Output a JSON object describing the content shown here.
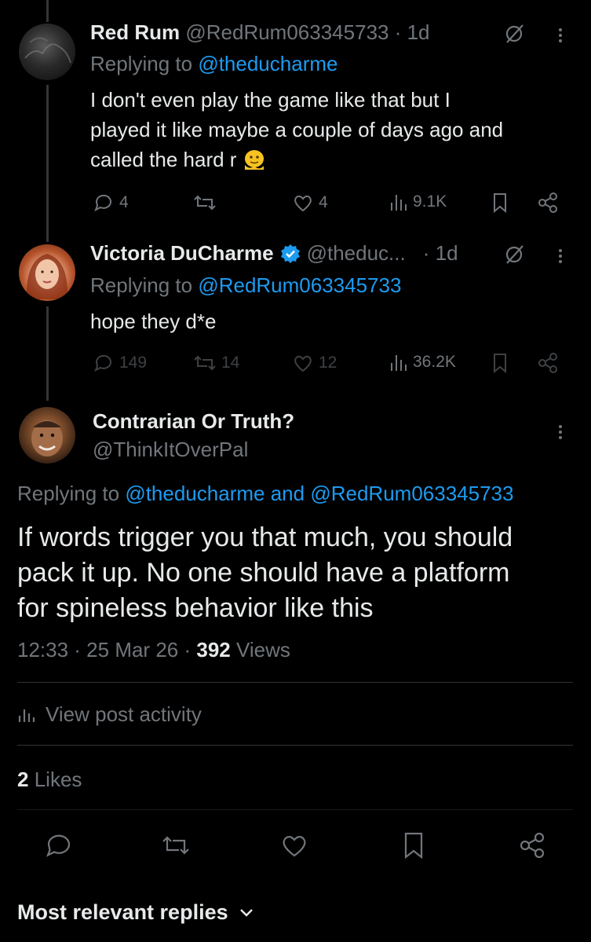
{
  "replies": [
    {
      "name": "Red Rum",
      "handle": "@RedRum063345733",
      "time": "· 1d",
      "replying_prefix": "Replying to",
      "replying_to": "@theducharme",
      "text_lines": [
        "I don't even play the game like that but I",
        "played it like maybe a couple of days ago and",
        "called the hard r"
      ],
      "emoji": "🫠",
      "stats": {
        "replies": "4",
        "reposts": "",
        "likes": "4",
        "views": "9.1K"
      }
    },
    {
      "name": "Victoria DuCharme",
      "handle": "@theduc...",
      "time": "· 1d",
      "replying_prefix": "Replying to",
      "replying_to": "@RedRum063345733",
      "text_lines": [
        "hope they d*e"
      ],
      "stats": {
        "replies": "149",
        "reposts": "14",
        "likes": "12",
        "views": "36.2K"
      }
    }
  ],
  "main_post": {
    "name": "Contrarian Or Truth?",
    "handle": "@ThinkItOverPal",
    "replying_prefix": "Replying to",
    "replying_to_1": "@theducharme",
    "replying_and": "and",
    "replying_to_2": "@RedRum063345733",
    "text_lines": [
      "If words trigger you that much, you should",
      "pack it up. No one should have a platform",
      "for spineless behavior like this"
    ],
    "time": "12:33 · 25 Mar 26 ·",
    "views_count": "392",
    "views_label": "Views",
    "activity_label": "View post activity",
    "likes_count": "2",
    "likes_label": "Likes"
  },
  "sort_label": "Most relevant replies",
  "colors": {
    "background": "#000000",
    "text": "#e7e9ea",
    "secondary": "#71767b",
    "accent": "#1d9bf0",
    "verified": "#1d9bf0"
  },
  "icons": [
    "reply-icon",
    "repost-icon",
    "like-icon",
    "views-icon",
    "bookmark-icon",
    "share-icon",
    "mute-icon",
    "more-icon",
    "verified-icon",
    "chevron-down-icon"
  ]
}
